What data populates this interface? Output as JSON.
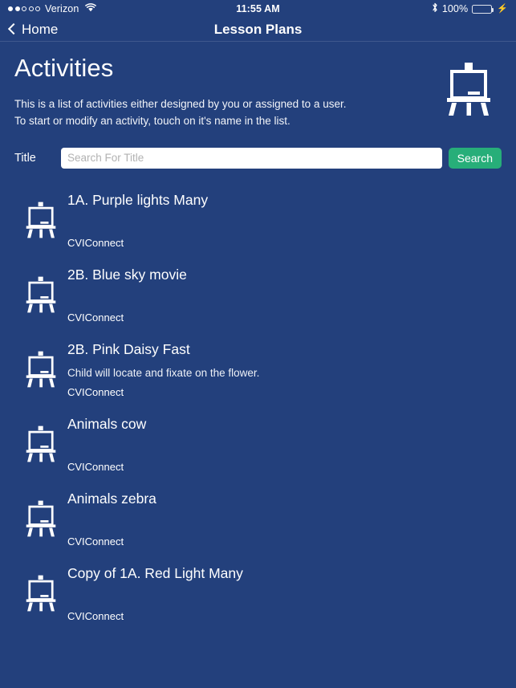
{
  "status_bar": {
    "signal_total": 5,
    "signal_filled": 2,
    "carrier": "Verizon",
    "wifi_icon": "wifi-icon",
    "time": "11:55 AM",
    "bluetooth_icon": "bluetooth-icon",
    "battery_percent": "100%",
    "battery_level": 100,
    "battery_color": "#4cd964",
    "charging_icon": "charging-bolt-icon"
  },
  "nav_bar": {
    "back_icon": "chevron-left-icon",
    "back_label": "Home",
    "title": "Lesson Plans"
  },
  "header": {
    "title": "Activities",
    "description_line1": "This is a list of activities either designed by you or assigned to a user.",
    "description_line2": "To start or modify an activity, touch on it's name in the list.",
    "icon": "easel-icon"
  },
  "search": {
    "label": "Title",
    "placeholder": "Search For Title",
    "value": "",
    "button_label": "Search",
    "button_color": "#27ae79"
  },
  "theme": {
    "background": "#23407c",
    "text": "#ffffff"
  },
  "activities": [
    {
      "icon": "easel-icon",
      "title": "1A. Purple lights Many",
      "description": "",
      "owner": "CVIConnect"
    },
    {
      "icon": "easel-icon",
      "title": "2B. Blue sky movie",
      "description": "",
      "owner": "CVIConnect"
    },
    {
      "icon": "easel-icon",
      "title": "2B. Pink Daisy Fast",
      "description": "Child will locate and fixate on the flower.",
      "owner": "CVIConnect"
    },
    {
      "icon": "easel-icon",
      "title": "Animals cow",
      "description": "",
      "owner": "CVIConnect"
    },
    {
      "icon": "easel-icon",
      "title": "Animals zebra",
      "description": "",
      "owner": "CVIConnect"
    },
    {
      "icon": "easel-icon",
      "title": "Copy of 1A. Red Light Many",
      "description": "",
      "owner": "CVIConnect"
    }
  ]
}
